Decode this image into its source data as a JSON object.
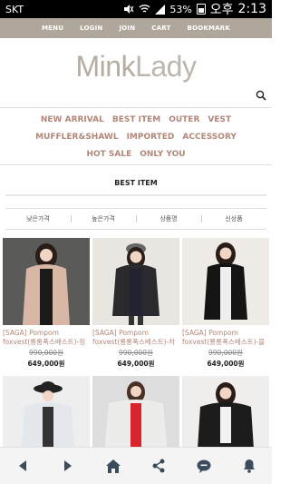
{
  "status": {
    "carrier": "SKT",
    "battery": "53%",
    "ampm": "오후",
    "time": "2:13"
  },
  "topnav": [
    "MENU",
    "LOGIN",
    "JOIN",
    "CART",
    "BOOKMARK"
  ],
  "logo": {
    "part1": "Mink",
    "part2": "Lady"
  },
  "categories": {
    "row1": [
      "NEW ARRIVAL",
      "BEST ITEM",
      "OUTER",
      "VEST"
    ],
    "row2": [
      "MUFFLER&SHAWL",
      "IMPORTED",
      "ACCESSORY"
    ],
    "row3": [
      "HOT SALE",
      "ONLY YOU"
    ]
  },
  "section_title": "BEST ITEM",
  "sort_options": [
    "낮은가격",
    "높은가격",
    "상품명",
    "신상품"
  ],
  "products": [
    {
      "name": "[SAGA] Pompom foxvest(롱롱폭스베스트)-핑크베이지",
      "old_price": "990,000원",
      "price": "649,000원",
      "fur": "#d9b7a6",
      "bg": "#5a5a58"
    },
    {
      "name": "[SAGA] Pompom foxvest(롱롱폭스베스트)-차콜그레이",
      "old_price": "990,000원",
      "price": "649,000원",
      "fur": "#2a2a2e",
      "bg": "#e9e6e2"
    },
    {
      "name": "[SAGA] Pompom foxvest(롱롱폭스베스트)-블랙",
      "old_price": "990,000원",
      "price": "649,000원",
      "fur": "#141414",
      "bg": "#efece8"
    },
    {
      "name": "",
      "old_price": "",
      "price": "",
      "fur": "#e4e7ec",
      "bg": "#eeeeee"
    },
    {
      "name": "",
      "old_price": "",
      "price": "",
      "fur": "#ececea",
      "bg": "#dddddd"
    },
    {
      "name": "",
      "old_price": "",
      "price": "",
      "fur": "#1c1c1c",
      "bg": "#efeeec"
    }
  ],
  "colors": {
    "topnav_bg": "#b0a79c",
    "category_text": "#b1877a",
    "logo": "#bdb6ae"
  },
  "bottom_icons": [
    "back-arrow-icon",
    "forward-arrow-icon",
    "home-icon",
    "share-icon",
    "chat-icon",
    "notification-bell-icon"
  ]
}
